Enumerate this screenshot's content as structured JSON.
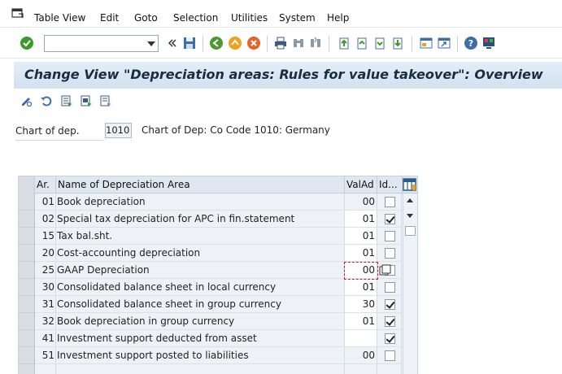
{
  "menu": {
    "items": [
      {
        "label": "Table View"
      },
      {
        "label": "Edit"
      },
      {
        "label": "Goto"
      },
      {
        "label": "Selection"
      },
      {
        "label": "Utilities"
      },
      {
        "label": "System"
      },
      {
        "label": "Help"
      }
    ]
  },
  "toolbar": {
    "command_field_value": "",
    "icons": [
      "enter-icon",
      "save-icon",
      "back-icon",
      "exit-icon",
      "cancel-icon",
      "print-icon",
      "find-icon",
      "find-next-icon",
      "first-page-icon",
      "previous-page-icon",
      "next-page-icon",
      "last-page-icon",
      "create-session-icon",
      "shortcut-icon",
      "help-icon",
      "customize-layout-icon"
    ]
  },
  "screen": {
    "title": "Change View \"Depreciation areas: Rules for value takeover\": Overview"
  },
  "header_field": {
    "label": "Chart of dep.",
    "value": "1010",
    "description": "Chart of Dep: Co Code 1010: Germany"
  },
  "table": {
    "columns": [
      "Ar.",
      "Name of Depreciation Area",
      "ValAd",
      "Id..."
    ],
    "rows": [
      {
        "ar": "01",
        "name": "Book depreciation",
        "valad": "00",
        "valad_editable": false,
        "id": false
      },
      {
        "ar": "02",
        "name": "Special tax depreciation for APC in fin.statement",
        "valad": "01",
        "valad_editable": true,
        "id": true
      },
      {
        "ar": "15",
        "name": "Tax bal.sht.",
        "valad": "01",
        "valad_editable": true,
        "id": false
      },
      {
        "ar": "20",
        "name": "Cost-accounting depreciation",
        "valad": "01",
        "valad_editable": true,
        "id": false
      },
      {
        "ar": "25",
        "name": "GAAP Depreciation",
        "valad": "00",
        "valad_editable": true,
        "id": false
      },
      {
        "ar": "30",
        "name": "Consolidated balance sheet in local currency",
        "valad": "01",
        "valad_editable": true,
        "id": false
      },
      {
        "ar": "31",
        "name": "Consolidated balance sheet in group currency",
        "valad": "30",
        "valad_editable": true,
        "id": true
      },
      {
        "ar": "32",
        "name": "Book depreciation in group currency",
        "valad": "01",
        "valad_editable": true,
        "id": true
      },
      {
        "ar": "41",
        "name": "Investment support deducted from asset",
        "valad": "",
        "valad_editable": true,
        "id": true
      },
      {
        "ar": "51",
        "name": "Investment support posted to liabilities",
        "valad": "00",
        "valad_editable": false,
        "id": false
      }
    ]
  }
}
